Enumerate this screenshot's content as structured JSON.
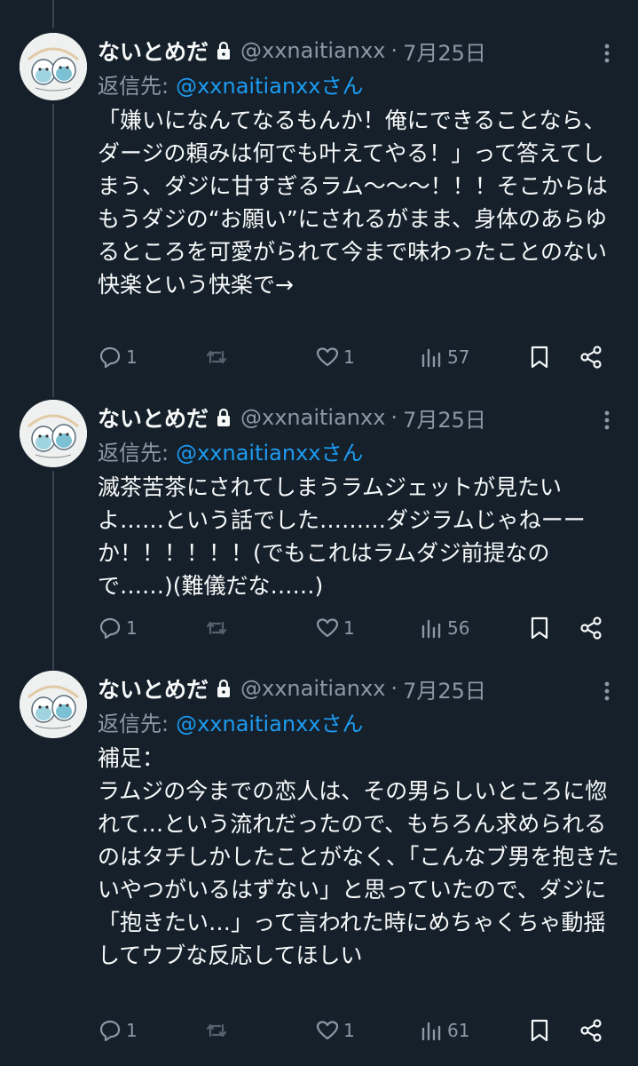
{
  "tweets": [
    {
      "name": "ないとめだ",
      "handle": "@xxnaitianxx",
      "date": "7月25日",
      "reply_label": "返信先:",
      "reply_target": "@xxnaitianxxさん",
      "text": "「嫌いになんてなるもんか！俺にできることなら、ダージの頼みは何でも叶えてやる！」って答えてしまう、ダジに甘すぎるラム〜〜〜！！！そこからはもうダジの“お願い”にされるがまま、身体のあらゆるところを可愛がられて今まで味わったことのない快楽という快楽で→",
      "reply_count": "1",
      "retweet_count": "",
      "like_count": "1",
      "view_count": "57"
    },
    {
      "name": "ないとめだ",
      "handle": "@xxnaitianxx",
      "date": "7月25日",
      "reply_label": "返信先:",
      "reply_target": "@xxnaitianxxさん",
      "text": "滅茶苦茶にされてしまうラムジェットが見たいよ……という話でした………ダジラムじゃねーーか！！！！！！(でもこれはラムダジ前提なので……)(難儀だな……)",
      "reply_count": "1",
      "retweet_count": "",
      "like_count": "1",
      "view_count": "56"
    },
    {
      "name": "ないとめだ",
      "handle": "@xxnaitianxx",
      "date": "7月25日",
      "reply_label": "返信先:",
      "reply_target": "@xxnaitianxxさん",
      "text": "補足：\nラムジの今までの恋人は、その男らしいところに惚れて…という流れだったので、もちろん求められるのはタチしかしたことがなく、「こんなブ男を抱きたいやつがいるはずない」と思っていたので、ダジに「抱きたい…」って言われた時にめちゃくちゃ動揺してウブな反応してほしい",
      "reply_count": "1",
      "retweet_count": "",
      "like_count": "1",
      "view_count": "61"
    }
  ],
  "icons": {
    "lock": "lock-icon",
    "more": "more-icon",
    "reply": "reply-icon",
    "retweet": "retweet-icon",
    "like": "heart-icon",
    "views": "views-icon",
    "bookmark": "bookmark-icon",
    "share": "share-icon"
  },
  "colors": {
    "background": "#15202b",
    "text": "#f7f9f9",
    "muted": "#8b98a5",
    "link": "#1d9bf0",
    "thread_line": "#38444d"
  }
}
